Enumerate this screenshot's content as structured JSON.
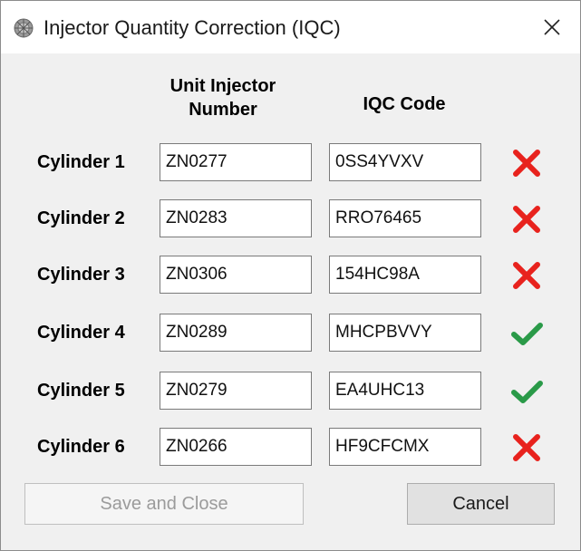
{
  "window": {
    "title": "Injector Quantity Correction (IQC)",
    "close_label": "×"
  },
  "headers": {
    "unit_injector_line1": "Unit Injector",
    "unit_injector_line2": "Number",
    "iqc_code": "IQC Code"
  },
  "rows": [
    {
      "label": "Cylinder 1",
      "unit_injector": "ZN0277",
      "iqc_code": "0SS4YVXV",
      "status": "invalid"
    },
    {
      "label": "Cylinder 2",
      "unit_injector": "ZN0283",
      "iqc_code": "RRO76465",
      "status": "invalid"
    },
    {
      "label": "Cylinder 3",
      "unit_injector": "ZN0306",
      "iqc_code": "154HC98A",
      "status": "invalid"
    },
    {
      "label": "Cylinder 4",
      "unit_injector": "ZN0289",
      "iqc_code": "MHCPBVVY",
      "status": "valid"
    },
    {
      "label": "Cylinder 5",
      "unit_injector": "ZN0279",
      "iqc_code": "EA4UHC13",
      "status": "valid"
    },
    {
      "label": "Cylinder 6",
      "unit_injector": "ZN0266",
      "iqc_code": "HF9CFCMX",
      "status": "invalid"
    }
  ],
  "buttons": {
    "save_close": "Save and Close",
    "cancel": "Cancel"
  },
  "colors": {
    "invalid": "#e8221d",
    "valid": "#2a9a48"
  }
}
